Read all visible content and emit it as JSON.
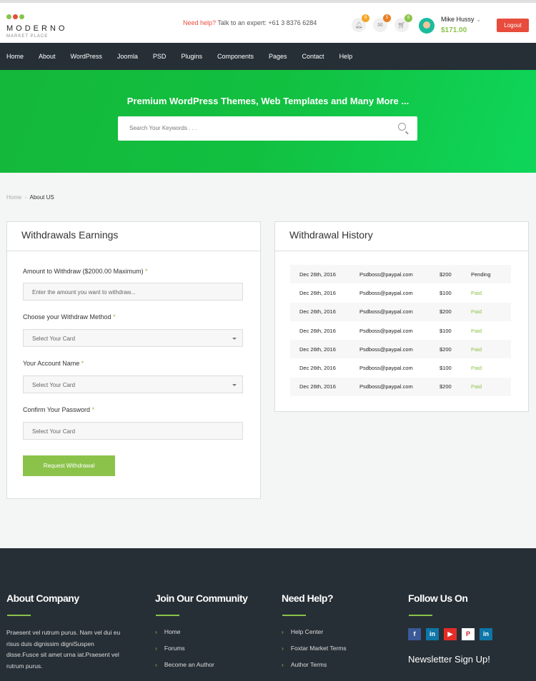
{
  "header": {
    "logo_name": "MODERNO",
    "logo_sub": "MARKET PLACE",
    "logo_dot_colors": [
      "#8bc34a",
      "#e74c3c",
      "#8bc34a"
    ],
    "help_label": "Need help?",
    "help_text": "Talk to an expert: +61 3 8376 6284",
    "icons": [
      {
        "icon": "bell-icon",
        "glyph": "🔔︎",
        "badge": "8",
        "color": "#f5a623"
      },
      {
        "icon": "mail-icon",
        "glyph": "✉",
        "badge": "5",
        "color": "#e67e22"
      },
      {
        "icon": "cart-icon",
        "glyph": "🛒︎",
        "badge": "8",
        "color": "#8bc34a"
      }
    ],
    "user_name": "Mike Hussy",
    "balance": "$171.00",
    "logout": "Logout"
  },
  "nav": [
    "Home",
    "About",
    "WordPress",
    "Joomla",
    "PSD",
    "Plugins",
    "Components",
    "Pages",
    "Contact",
    "Help"
  ],
  "hero": {
    "title": "Premium WordPress Themes, Web Templates and Many More ...",
    "search_placeholder": "Search Your Keywords . . ."
  },
  "breadcrumb": {
    "home": "Home",
    "sep": "-",
    "current": "About US"
  },
  "withdraw": {
    "title": "Withdrawals Earnings",
    "amount_label": "Amount to Withdraw ($2000.00 Maximum)",
    "amount_placeholder": "Enter the amount you want to withdraw...",
    "method_label": "Choose your Withdraw Method",
    "method_value": "Select Your Card",
    "account_label": "Your Account Name",
    "account_value": "Select Your Card",
    "password_label": "Confirm Your Password",
    "password_placeholder": "Select Your Card",
    "required": "*",
    "button": "Request Withdrawal"
  },
  "history": {
    "title": "Withdrawal History",
    "rows": [
      [
        "Dec 26th, 2016",
        "Psdboss@paypal.com",
        "$200",
        "Pending"
      ],
      [
        "Dec 26th, 2016",
        "Psdboss@paypal.com",
        "$100",
        "Paid"
      ],
      [
        "Dec 26th, 2016",
        "Psdboss@paypal.com",
        "$200",
        "Paid"
      ],
      [
        "Dec 26th, 2016",
        "Psdboss@paypal.com",
        "$100",
        "Paid"
      ],
      [
        "Dec 26th, 2016",
        "Psdboss@paypal.com",
        "$200",
        "Paid"
      ],
      [
        "Dec 26th, 2016",
        "Psdboss@paypal.com",
        "$100",
        "Paid"
      ],
      [
        "Dec 26th, 2016",
        "Psdboss@paypal.com",
        "$200",
        "Paid"
      ]
    ]
  },
  "footer": {
    "about_title": "About Company",
    "about_text": "Praesent vel rutrum purus. Nam vel dui eu risus duis dignissim digniSuspen disse.Fusce sit amet urna iat.Praesent vel rutrum purus.",
    "community_title": "Join Our Community",
    "community_links": [
      "Home",
      "Forums",
      "Become an Author"
    ],
    "help_title": "Need Help?",
    "help_links": [
      "Help Center",
      "Foxtar Market Terms",
      "Author Terms"
    ],
    "follow_title": "Follow Us On",
    "social": [
      {
        "icon": "facebook-icon",
        "glyph": "f",
        "color": "#3b5998"
      },
      {
        "icon": "linkedin-icon",
        "glyph": "in",
        "color": "#0e76a8"
      },
      {
        "icon": "youtube-icon",
        "glyph": "▶",
        "color": "#e52d27"
      },
      {
        "icon": "pinterest-icon",
        "glyph": "P",
        "color": "#ffffff"
      },
      {
        "icon": "linkedin-icon",
        "glyph": "in",
        "color": "#0e76a8"
      }
    ],
    "newsletter_title": "Newsletter Sign Up!"
  }
}
